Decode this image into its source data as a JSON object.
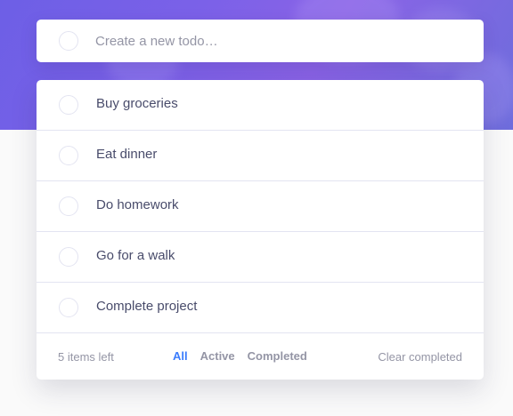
{
  "new_todo": {
    "placeholder": "Create a new todo…"
  },
  "todos": [
    {
      "label": "Buy groceries",
      "completed": false
    },
    {
      "label": "Eat dinner",
      "completed": false
    },
    {
      "label": "Do homework",
      "completed": false
    },
    {
      "label": "Go for a walk",
      "completed": false
    },
    {
      "label": "Complete project",
      "completed": false
    }
  ],
  "footer": {
    "items_left": "5 items left",
    "filters": [
      "All",
      "Active",
      "Completed"
    ],
    "active_filter": "All",
    "clear_label": "Clear completed"
  },
  "colors": {
    "accent": "#3a7cfd",
    "text": "#494c6b",
    "muted": "#9495a5",
    "border": "#e3e4f1",
    "header_gradient_start": "#6d5fe6",
    "header_gradient_end": "#6e6ddc"
  }
}
